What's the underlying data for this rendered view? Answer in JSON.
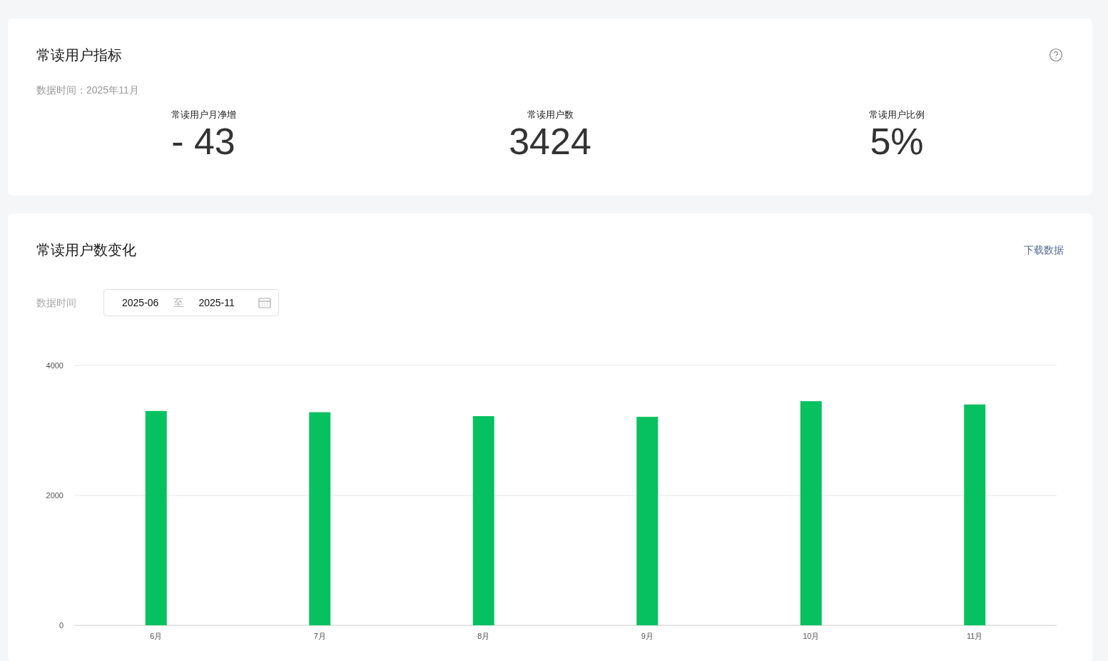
{
  "metrics_card": {
    "title": "常读用户指标",
    "data_time": "数据时间：2025年11月",
    "metrics": [
      {
        "label": "常读用户月净增",
        "value": "- 43"
      },
      {
        "label": "常读用户数",
        "value": "3424"
      },
      {
        "label": "常读用户比例",
        "value": "5%"
      }
    ]
  },
  "trend_card": {
    "title": "常读用户数变化",
    "download_link": "下载数据",
    "date_label": "数据时间",
    "date_start": "2025-06",
    "date_separator": "至",
    "date_end": "2025-11",
    "chart_data": {
      "type": "bar",
      "categories": [
        "6月",
        "7月",
        "8月",
        "9月",
        "10月",
        "11月"
      ],
      "series": [
        {
          "color": "#07c160",
          "values": [
            3300,
            3280,
            3220,
            3210,
            3450,
            3400
          ]
        }
      ],
      "ylim": [
        0,
        4000
      ],
      "yticks": [
        0,
        2000,
        4000
      ]
    }
  }
}
